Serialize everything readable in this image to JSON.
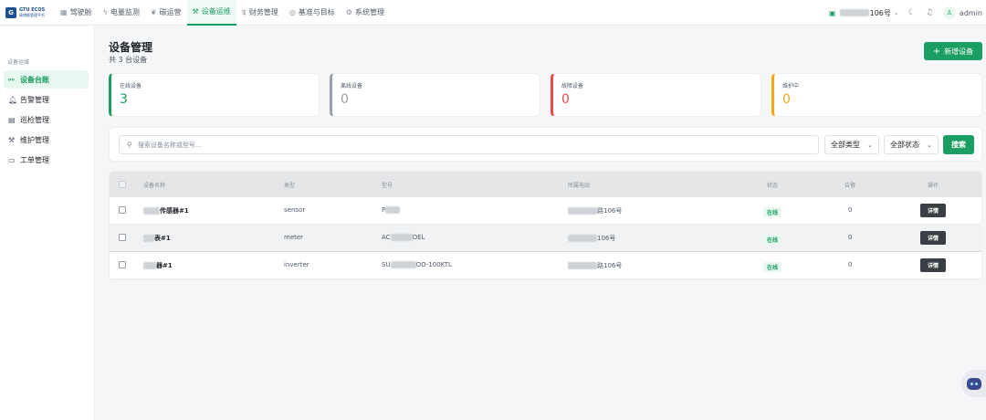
{
  "brand": {
    "line1": "GTU ECOS",
    "line2": "碳储能管理平台",
    "mark": "G"
  },
  "nav": [
    {
      "label": "驾驶舱",
      "icon": "dashboard-icon",
      "glyph": "▦"
    },
    {
      "label": "电量监测",
      "icon": "lightning-icon",
      "glyph": "ϟ"
    },
    {
      "label": "碳运营",
      "icon": "leaf-icon",
      "glyph": "❦"
    },
    {
      "label": "设备运维",
      "icon": "wrench-icon",
      "glyph": "⚒",
      "active": true
    },
    {
      "label": "财务管理",
      "icon": "dollar-icon",
      "glyph": "$"
    },
    {
      "label": "基准与目标",
      "icon": "target-icon",
      "glyph": "◎"
    },
    {
      "label": "系统管理",
      "icon": "gear-icon",
      "glyph": "⚙"
    }
  ],
  "topright": {
    "site_suffix": "106号",
    "user": "admin"
  },
  "sidebar": {
    "group": "设备运维",
    "items": [
      {
        "label": "设备台账",
        "icon": "ledger-icon",
        "glyph": "⚯",
        "active": true
      },
      {
        "label": "告警管理",
        "icon": "bell-icon",
        "glyph": "🔔︎"
      },
      {
        "label": "巡检管理",
        "icon": "clipboard-icon",
        "glyph": "▤"
      },
      {
        "label": "维护管理",
        "icon": "wrench-icon",
        "glyph": "⚒"
      },
      {
        "label": "工单管理",
        "icon": "document-icon",
        "glyph": "▭"
      }
    ]
  },
  "page": {
    "title": "设备管理",
    "subtitle": "共 3 台设备",
    "add_label": "新增设备"
  },
  "stats": [
    {
      "label": "在线设备",
      "value": "3",
      "color": "#1a9e63"
    },
    {
      "label": "离线设备",
      "value": "0",
      "color": "#9aa0a6"
    },
    {
      "label": "故障设备",
      "value": "0",
      "color": "#e84a4a"
    },
    {
      "label": "维护中",
      "value": "0",
      "color": "#f0a818"
    }
  ],
  "filter": {
    "placeholder": "搜索设备名称或型号...",
    "type_select": "全部类型",
    "status_select": "全部状态",
    "search_label": "搜索"
  },
  "table": {
    "headers": [
      "设备名称",
      "类型",
      "型号",
      "所属电站",
      "状态",
      "告警",
      "操作"
    ],
    "rows": [
      {
        "name": "传感器#1",
        "type": "sensor",
        "model_prefix": "P",
        "model_suffix": "",
        "station_suffix": "路106号",
        "status": "在线",
        "alarms": "0",
        "action": "详情"
      },
      {
        "name": "表#1",
        "type": "meter",
        "model_prefix": "AC",
        "model_suffix": "OEL",
        "station_suffix": "106号",
        "status": "在线",
        "alarms": "0",
        "action": "详情"
      },
      {
        "name": "器#1",
        "type": "inverter",
        "model_prefix": "SU",
        "model_suffix": "OO-100KTL",
        "station_suffix": "路106号",
        "status": "在线",
        "alarms": "0",
        "action": "详情"
      }
    ]
  }
}
